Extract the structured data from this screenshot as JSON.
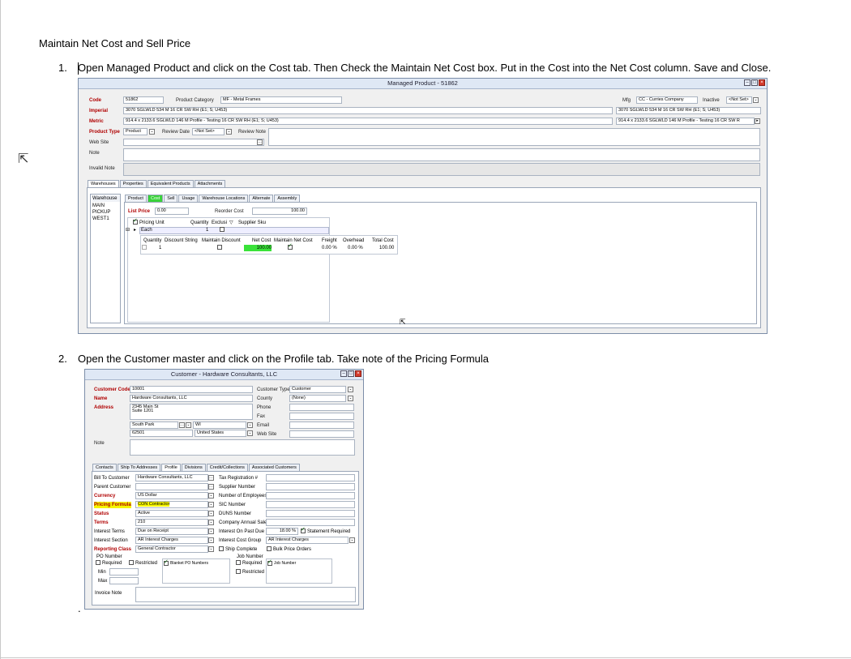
{
  "doc": {
    "title": "Maintain Net Cost and Sell Price",
    "step1_num": "1.",
    "step1_text": "Open Managed Product and click on the Cost tab. Then Check the Maintain Net Cost box. Put in the Cost into the Net Cost column. Save and Close.",
    "step2_num": "2.",
    "step2_text": "Open the Customer master and click on the Profile tab. Take note of the Pricing Formula",
    "trailing_dot": "."
  },
  "product_window": {
    "title": "Managed Product - 51862",
    "labels": {
      "code": "Code",
      "imperial": "Imperial",
      "metric": "Metric",
      "product_type": "Product Type",
      "web_site": "Web Site",
      "note": "Note",
      "invalid_note": "Invalid Note",
      "product_category": "Product Category",
      "review_date": "Review Date",
      "review_note": "Review Note",
      "mfg": "Mfg",
      "inactive": "Inactive"
    },
    "values": {
      "code": "51862",
      "product_category": "MF - Metal Frames",
      "imperial": "3070 SGLWLD 534 M 16 CR SW RH (E1; S; U453)",
      "metric": "914.4 x 2133.6 SGLWLD 146 M Profile - Testing 16 CR SW RH (E1; S; U453)",
      "product_type": "Product",
      "review_date": "<Not Set>",
      "mfg": "CC - Curries Company",
      "inactive": "<Not Set>",
      "imperial_right": "3070 SGLWLD 534 M 16 CR SW RH (E1; S; U453)",
      "metric_right": "914.4 x 2133.6 SGLWLD 146 M Profile - Testing 16 CR SW R"
    },
    "main_tabs": [
      "Warehouses",
      "Properties",
      "Equivalent Products",
      "Attachments"
    ],
    "warehouse_header": "Warehouse",
    "warehouses": [
      "MAIN",
      "PICKUP",
      "WEST1"
    ],
    "sub_tabs": [
      "Product",
      "Cost",
      "Sell",
      "Usage",
      "Warehouse Locations",
      "Alternate",
      "Assembly"
    ],
    "list_price_label": "List Price",
    "list_price": "0.00",
    "reorder_cost_label": "Reorder Cost",
    "reorder_cost": "100.00",
    "grid_headers": [
      "Pricing Unit",
      "Quantity",
      "Exclusi",
      "Supplier Sku"
    ],
    "row_unit": "Each",
    "row_qty": "1",
    "sub_headers": [
      "Quantity",
      "Discount String",
      "Maintain Discount",
      "Net Cost",
      "Maintain Net Cost",
      "Freight",
      "Overhead",
      "Total Cost"
    ],
    "sub_row": {
      "quantity": "1",
      "net_cost": "100.00",
      "freight": "0.00 %",
      "overhead": "0.00 %",
      "total_cost": "100.00"
    }
  },
  "customer_window": {
    "title": "Customer - Hardware Consultants, LLC",
    "labels": {
      "customer_code": "Customer Code",
      "name": "Name",
      "address": "Address",
      "note": "Note",
      "customer_type": "Customer Type",
      "county": "County",
      "phone": "Phone",
      "fax": "Fax",
      "email": "Email",
      "web_site": "Web Site"
    },
    "values": {
      "customer_code": "10001",
      "name": "Hardware Consultants, LLC",
      "address1": "2345 Main St",
      "address2": "Suite 1201",
      "city": "South Park",
      "state": "WI",
      "zip": "62501",
      "country": "United States",
      "customer_type": "Customer",
      "county": "(None)"
    },
    "tabs": [
      "Contacts",
      "Ship To Addresses",
      "Profile",
      "Divisions",
      "Credit/Collections",
      "Associated Customers"
    ],
    "profile_left": [
      {
        "label": "Bill To Customer",
        "value": "Hardware Consultants, LLC",
        "req": false
      },
      {
        "label": "Parent Customer",
        "value": "",
        "req": false
      },
      {
        "label": "Currency",
        "value": "US Dollar",
        "req": true
      },
      {
        "label": "Pricing Formula",
        "value": "CON Contractor",
        "req": true
      },
      {
        "label": "Status",
        "value": "Active",
        "req": true
      },
      {
        "label": "Terms",
        "value": "210",
        "req": true
      },
      {
        "label": "Interest Terms",
        "value": "Due on Receipt",
        "req": false
      },
      {
        "label": "Interest Section",
        "value": "AR Interest Charges",
        "req": false
      },
      {
        "label": "Reporting Class",
        "value": "General Contractor",
        "req": true
      }
    ],
    "profile_right": [
      "Tax Registration #",
      "Supplier Number",
      "Number of Employees",
      "SIC Number",
      "DUNS Number",
      "Company Annual Sales",
      "Interest On Past Due",
      "Interest Cost Group",
      "Ship Complete"
    ],
    "interest_rate": "18.00 %",
    "statement_required": "Statement Required",
    "interest_cost_group": "AR Interest Charges",
    "bulk_price_orders": "Bulk Price Orders",
    "po_number": "PO Number",
    "po_required": "Required",
    "po_restricted": "Restricted",
    "blanket_po": "Blanket PO Numbers",
    "min": "Min",
    "max": "Max",
    "job_number": "Job Number",
    "job_required": "Required",
    "job_restricted": "Restricted",
    "job_number_col": "Job Number",
    "invoice_note": "Invoice Note"
  }
}
